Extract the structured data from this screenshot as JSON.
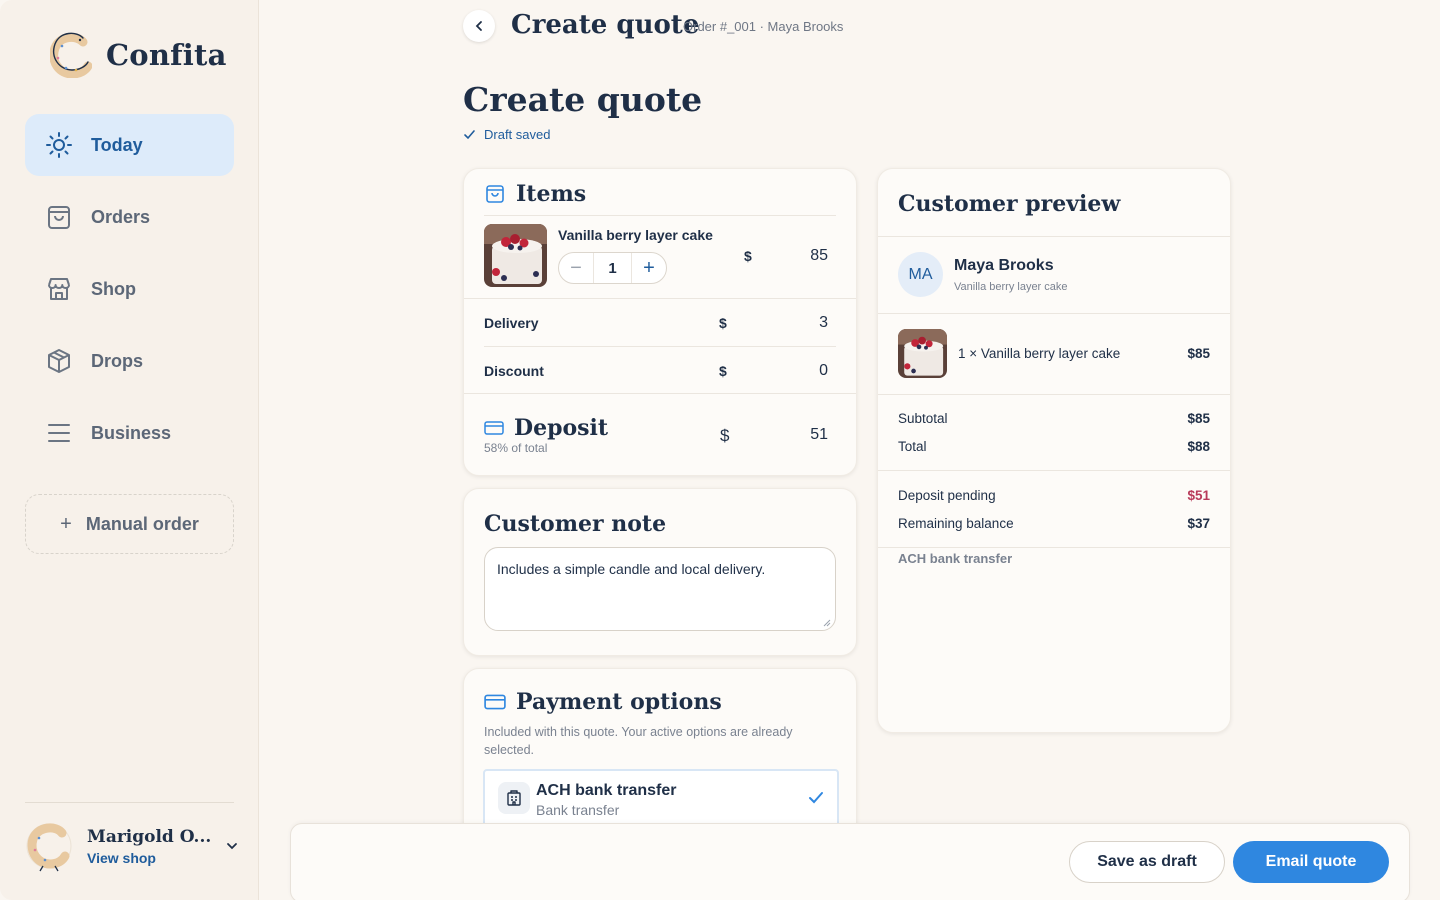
{
  "brand": {
    "name": "Confita",
    "logo_icon": "donut-c-logo"
  },
  "nav": {
    "items": [
      {
        "label": "Today",
        "icon": "sun-icon",
        "active": true
      },
      {
        "label": "Orders",
        "icon": "bag-icon",
        "active": false
      },
      {
        "label": "Shop",
        "icon": "storefront-icon",
        "active": false
      },
      {
        "label": "Drops",
        "icon": "box-icon",
        "active": false
      },
      {
        "label": "Business",
        "icon": "menu-lines-icon",
        "active": false
      }
    ],
    "manual_order": "Manual order"
  },
  "profile": {
    "name": "Marigold O...",
    "link": "View shop"
  },
  "header": {
    "title": "Create quote",
    "subtitle": "Order #_001 · Maya Brooks"
  },
  "page": {
    "title": "Create quote",
    "draft_status": "Draft saved"
  },
  "items_card": {
    "title": "Items",
    "item": {
      "name": "Vanilla berry layer cake",
      "quantity": "1",
      "currency": "$",
      "price": "85"
    },
    "delivery": {
      "label": "Delivery",
      "currency": "$",
      "value": "3"
    },
    "discount": {
      "label": "Discount",
      "currency": "$",
      "value": "0"
    },
    "deposit": {
      "label": "Deposit",
      "sub": "58% of total",
      "currency": "$",
      "value": "51"
    }
  },
  "note_card": {
    "title": "Customer note",
    "text": "Includes a simple candle and local delivery."
  },
  "payment_card": {
    "title": "Payment options",
    "description": "Included with this quote. Your active options are already selected.",
    "option": {
      "name": "ACH bank transfer",
      "sub": "Bank transfer",
      "selected": true
    }
  },
  "preview": {
    "title": "Customer preview",
    "initials": "MA",
    "customer_name": "Maya Brooks",
    "customer_sub": "Vanilla berry layer cake",
    "line_item": "1 × Vanilla berry layer cake",
    "line_price": "$85",
    "subtotal_label": "Subtotal",
    "subtotal": "$85",
    "total_label": "Total",
    "total": "$88",
    "deposit_label": "Deposit pending",
    "deposit": "$51",
    "remaining_label": "Remaining balance",
    "remaining": "$37",
    "payment_method": "ACH bank transfer"
  },
  "footer": {
    "save_draft": "Save as draft",
    "email_quote": "Email quote"
  },
  "colors": {
    "accent": "#2f87e0",
    "brand_text": "#1f2f47",
    "active_nav_bg": "#ddebfa",
    "pending": "#b83a5a"
  }
}
